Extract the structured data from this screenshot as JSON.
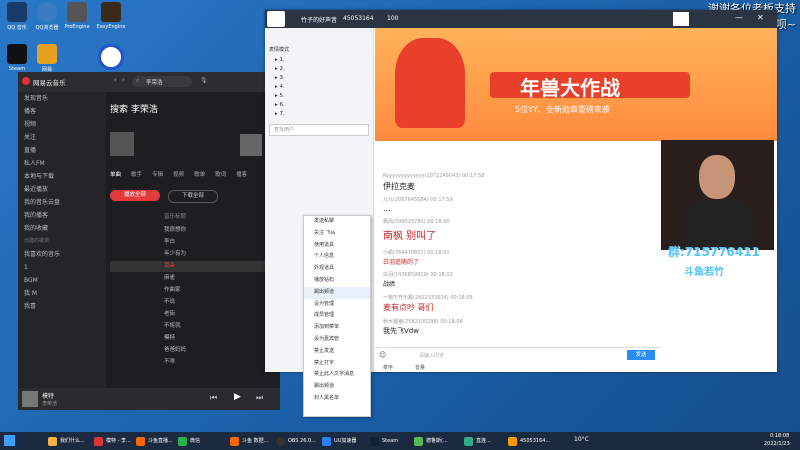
{
  "overlay_text": {
    "thanks": "谢谢各位老板支持",
    "fans": "旰命钓粉呗~"
  },
  "desktop_icons": [
    "QQ 音乐",
    "QQ浏览器",
    "ProEngine",
    "EasyEngine",
    "Steam",
    "网易",
    "wy"
  ],
  "netease": {
    "app_title": "网易云音乐",
    "search_value": "李荣浩",
    "search_heading": "搜索 李荣浩",
    "sidebar": [
      "发现音乐",
      "播客",
      "视频",
      "关注",
      "直播",
      "私人FM",
      "本地与下载",
      "最近播放",
      "我的音乐云盘",
      "我的播客",
      "我的收藏"
    ],
    "sidebar_section": "创建的歌单",
    "playlists": [
      "我喜欢的音乐",
      "1",
      "BGM",
      "我 M",
      "我喜"
    ],
    "tabs": [
      "单曲",
      "歌手",
      "专辑",
      "视频",
      "歌单",
      "歌词",
      "播客",
      "声音",
      "用户"
    ],
    "play_all": "播放全部",
    "download_all": "下载全部",
    "song_list_header": "音乐标题",
    "songs": [
      "我很想你",
      "李白",
      "年少有为",
      "耳朵",
      "麻雀",
      "作曲家",
      "不说",
      "老街",
      "不将就",
      "模特",
      "爸爸妈妈",
      "不乖"
    ],
    "now_playing": {
      "title": "模特",
      "artist": "李荣浩"
    }
  },
  "yy": {
    "title": "竹子的好声音",
    "room_id": "45053164",
    "online": "100",
    "left_tab_label": "表情模式",
    "search_placeholder": "查找用户",
    "banner_text": "年兽大作战",
    "banner_sub": "5位YY、全新勋章重磅来袭",
    "messages": [
      {
        "user": "Ryyyyyyyyyyyyy(2072245043)",
        "time": "00:17:58",
        "text": "伊拉克麦"
      },
      {
        "user": "九九(2067645084)",
        "time": "00:17:59",
        "text": "..."
      },
      {
        "user": "枫风(599015780)",
        "time": "00:18:00",
        "text": "南枫 别叫了"
      },
      {
        "user": "小颜(764470807)",
        "time": "00:18:01",
        "text": "白羽追随的了"
      },
      {
        "user": "白羽(1436859919)",
        "time": "00:18:02",
        "text": "战绩"
      },
      {
        "user": "一抱不开乐跟(2422333624)",
        "time": "00:18:05",
        "text": "麦有点吵 哥们"
      },
      {
        "user": "秋水猪猪(2582105298)",
        "time": "00:18:06",
        "text": "我先飞Vdw"
      }
    ],
    "input_placeholder": "请输入内容",
    "send": "发送",
    "bottom_bar": [
      "麦序",
      "音量"
    ],
    "ctx_menu": [
      "发送私聊",
      "关注 飞ia",
      "使用道具",
      "个人信息",
      "外观道具",
      "播放钻石",
      "踢出频道",
      "设为管理",
      "成员管理",
      "添加到菜单",
      "设为嘉宾管",
      "禁止发送",
      "禁止打字",
      "禁止此人文字消息",
      "踢出频道",
      "封人黑名单"
    ]
  },
  "overlay": {
    "id_text": "群:715776411",
    "weibo": "斗鱼若竹"
  },
  "taskbar": {
    "items": [
      "我们什么...",
      "模特 - 李...",
      "斗鱼直播...",
      "微信",
      "斗鱼 数据...",
      "OBS 26.0...",
      "UU加速器",
      "Steam",
      "德鲁斯(...",
      "直连...",
      "45053164..."
    ],
    "weather": "10°C",
    "time": "0:18:08",
    "date": "2022/1/23"
  }
}
